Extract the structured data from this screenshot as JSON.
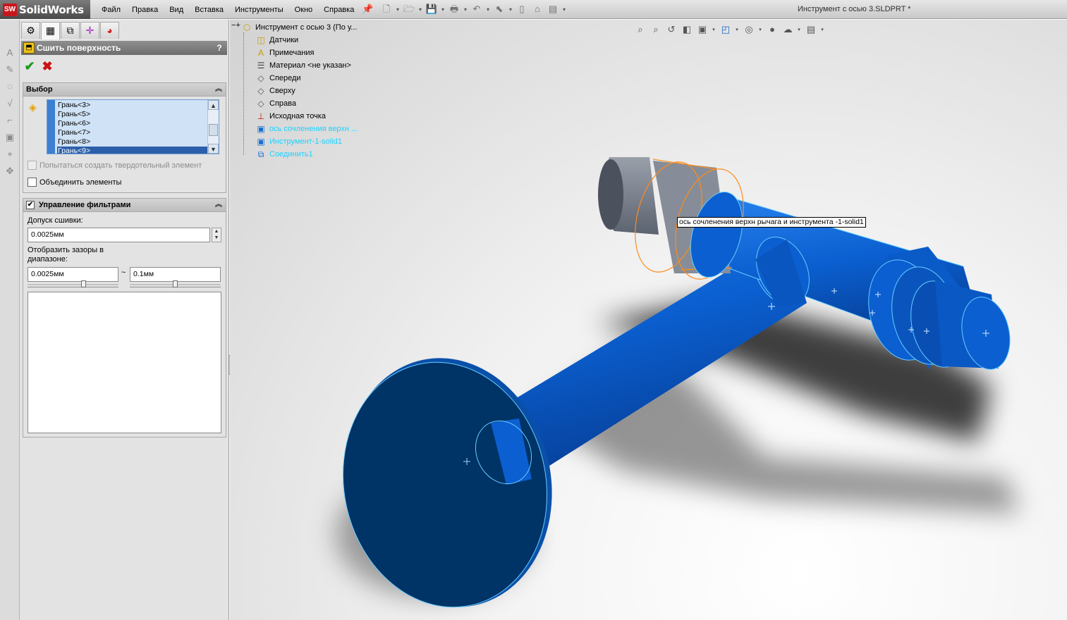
{
  "app": {
    "logo_badge": "SW",
    "logo_text": "SolidWorks",
    "document_title": "Инструмент с осью 3.SLDPRT *"
  },
  "menu": [
    "Файл",
    "Правка",
    "Вид",
    "Вставка",
    "Инструменты",
    "Окно",
    "Справка"
  ],
  "quick_toolbar_icons": [
    "new-document-icon",
    "open-icon",
    "save-icon",
    "print-icon",
    "undo-icon",
    "select-icon",
    "rebuild-icon",
    "file-properties-icon",
    "options-icon"
  ],
  "left_strip_icons": [
    "annotation-icon",
    "note-icon",
    "balloon-icon",
    "surface-finish-icon",
    "weld-symbol-icon",
    "datum-icon",
    "geometric-tolerance-icon",
    "smart-dimension-icon"
  ],
  "panel_tabs": [
    "feature-manager-tab",
    "property-manager-tab",
    "configuration-manager-tab",
    "dimxpert-manager-tab",
    "display-manager-tab"
  ],
  "property_manager": {
    "title": "Сшить поверхность",
    "help": "?",
    "ok_glyph": "✔",
    "cancel_glyph": "✖",
    "selection": {
      "title": "Выбор",
      "items": [
        "Грань<3>",
        "Грань<5>",
        "Грань<6>",
        "Грань<7>",
        "Грань<8>",
        "Грань<9>"
      ],
      "selected_index": 5,
      "try_solid_label": "Попытаться создать твердотельный элемент",
      "try_solid_checked": false,
      "try_solid_enabled": false,
      "merge_label": "Объединить элементы",
      "merge_checked": false
    },
    "filter": {
      "title": "Управление фильтрами",
      "enabled": true,
      "tolerance_label": "Допуск сшивки:",
      "tolerance_value": "0.0025мм",
      "gap_label": "Отобразить зазоры в диапазоне:",
      "gap_min": "0.0025мм",
      "gap_separator": "~",
      "gap_max": "0.1мм"
    }
  },
  "heads_up_icons": [
    "zoom-to-fit-icon",
    "zoom-to-area-icon",
    "previous-view-icon",
    "section-view-icon",
    "view-orientation-icon",
    "display-style-icon",
    "hide-show-items-icon",
    "edit-appearance-icon",
    "apply-scene-icon",
    "view-settings-icon"
  ],
  "feature_tree": [
    {
      "label": "Инструмент с осью 3  (По у...",
      "icon": "part-icon",
      "level": 0,
      "expanded": true,
      "highlight": false
    },
    {
      "label": "Датчики",
      "icon": "sensors-icon",
      "level": 1,
      "highlight": false
    },
    {
      "label": "Примечания",
      "icon": "annotations-icon",
      "level": 1,
      "collapsible": true,
      "highlight": false
    },
    {
      "label": "Материал <не указан>",
      "icon": "material-icon",
      "level": 1,
      "highlight": false
    },
    {
      "label": "Спереди",
      "icon": "plane-icon",
      "level": 1,
      "highlight": false
    },
    {
      "label": "Сверху",
      "icon": "plane-icon",
      "level": 1,
      "highlight": false
    },
    {
      "label": "Справа",
      "icon": "plane-icon",
      "level": 1,
      "highlight": false
    },
    {
      "label": "Исходная точка",
      "icon": "origin-icon",
      "level": 1,
      "highlight": false
    },
    {
      "label": "ось  сочленения верхн ...",
      "icon": "imported-body-icon",
      "level": 1,
      "highlight": true
    },
    {
      "label": "Инструмент-1-solid1",
      "icon": "imported-body-icon",
      "level": 1,
      "highlight": true
    },
    {
      "label": "Соединить1",
      "icon": "combine-icon",
      "level": 1,
      "highlight": true
    }
  ],
  "tooltip": "ось  сочленения верхн рычага и инструмента -1-solid1",
  "colors": {
    "model_blue": "#0a5ac8",
    "model_dark": "#003366",
    "edge_highlight": "#66ccff",
    "selected_edge": "#ff8c1a",
    "gray_part": "#6f7784",
    "tree_highlight": "#1ad2ff"
  }
}
